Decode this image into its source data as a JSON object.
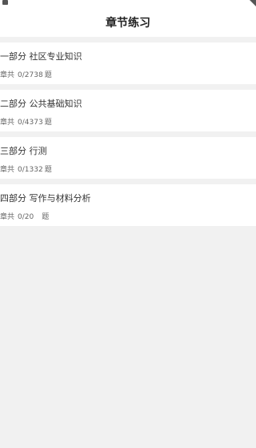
{
  "header": {
    "title": "章节练习"
  },
  "sections": [
    {
      "name": "一部分  社区专业知识",
      "label": "章共",
      "progress": "0/2738",
      "unit": "题"
    },
    {
      "name": "二部分  公共基础知识",
      "label": "章共",
      "progress": "0/4373",
      "unit": "题"
    },
    {
      "name": "三部分  行测",
      "label": "章共",
      "progress": "0/1332",
      "unit": "题"
    },
    {
      "name": "四部分  写作与材料分析",
      "label": "章共",
      "progress": "0/20",
      "unit": "题"
    }
  ]
}
